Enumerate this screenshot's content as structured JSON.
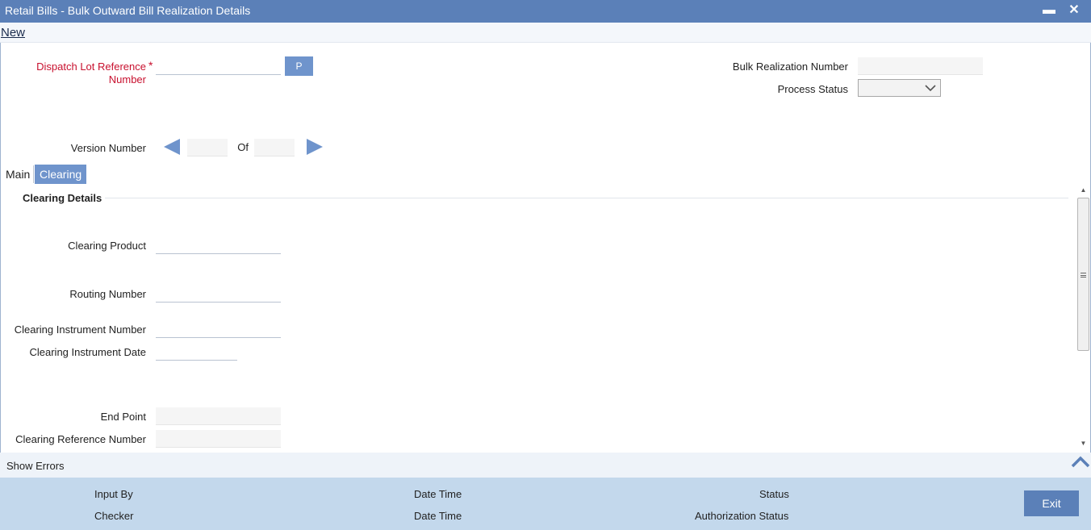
{
  "window": {
    "title": "Retail Bills - Bulk Outward Bill Realization Details",
    "minimize_glyph": "▬",
    "close_glyph": "✕"
  },
  "menu": {
    "new_label": "New"
  },
  "header": {
    "dispatch_lot_label_line1": "Dispatch Lot Reference",
    "dispatch_lot_label_line2": "Number",
    "required_marker": "*",
    "dispatch_lot_value": "",
    "p_button": "P",
    "bulk_realization_label": "Bulk Realization Number",
    "bulk_realization_value": "",
    "process_status_label": "Process Status",
    "process_status_value": "",
    "version_label": "Version Number",
    "version_value": "",
    "of_label": "Of",
    "of_value": ""
  },
  "tabs": [
    {
      "label": "Main",
      "active": false
    },
    {
      "label": "Clearing",
      "active": true
    }
  ],
  "clearing": {
    "section_title": "Clearing Details",
    "fields": {
      "product_label": "Clearing Product",
      "routing_label": "Routing Number",
      "instrument_number_label": "Clearing Instrument Number",
      "instrument_date_label": "Clearing Instrument Date",
      "end_point_label": "End Point",
      "reference_number_label": "Clearing Reference Number"
    }
  },
  "errors": {
    "show_errors_label": "Show Errors"
  },
  "footer": {
    "input_by_label": "Input By",
    "checker_label": "Checker",
    "date_time_label_1": "Date Time",
    "date_time_label_2": "Date Time",
    "status_label": "Status",
    "authorization_status_label": "Authorization Status",
    "exit_label": "Exit"
  },
  "colors": {
    "title_bar": "#5b80b8",
    "accent_button": "#6f94cc",
    "required_label": "#c8102e",
    "footer_bg": "#c3d8ec"
  },
  "icons": [
    "minimize-icon",
    "close-icon",
    "chevron-down-icon",
    "previous-arrow-icon",
    "next-arrow-icon",
    "collapse-up-icon",
    "scroll-grip-icon"
  ]
}
